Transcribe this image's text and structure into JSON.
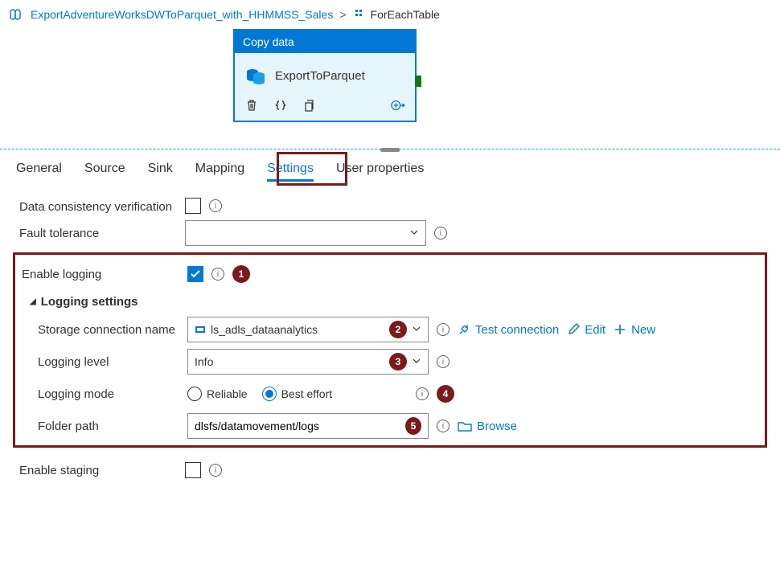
{
  "breadcrumb": {
    "pipeline": "ExportAdventureWorksDWToParquet_with_HHMMSS_Sales",
    "current": "ForEachTable",
    "sep": ">"
  },
  "activity": {
    "type_label": "Copy data",
    "name": "ExportToParquet"
  },
  "tabs": {
    "general": "General",
    "source": "Source",
    "sink": "Sink",
    "mapping": "Mapping",
    "settings": "Settings",
    "user_props": "User properties"
  },
  "form": {
    "data_consistency_label": "Data consistency verification",
    "fault_tolerance_label": "Fault tolerance",
    "fault_tolerance_value": "",
    "enable_logging_label": "Enable logging",
    "enable_logging_checked": true,
    "logging_settings_label": "Logging settings",
    "storage_conn_label": "Storage connection name",
    "storage_conn_value": "ls_adls_dataanalytics",
    "test_connection": "Test connection",
    "edit": "Edit",
    "new": "New",
    "logging_level_label": "Logging level",
    "logging_level_value": "Info",
    "logging_mode_label": "Logging mode",
    "logging_mode_reliable": "Reliable",
    "logging_mode_best_effort": "Best effort",
    "folder_path_label": "Folder path",
    "folder_path_value": "dlsfs/datamovement/logs",
    "browse": "Browse",
    "enable_staging_label": "Enable staging"
  },
  "annotations": {
    "n1": "1",
    "n2": "2",
    "n3": "3",
    "n4": "4",
    "n5": "5"
  }
}
